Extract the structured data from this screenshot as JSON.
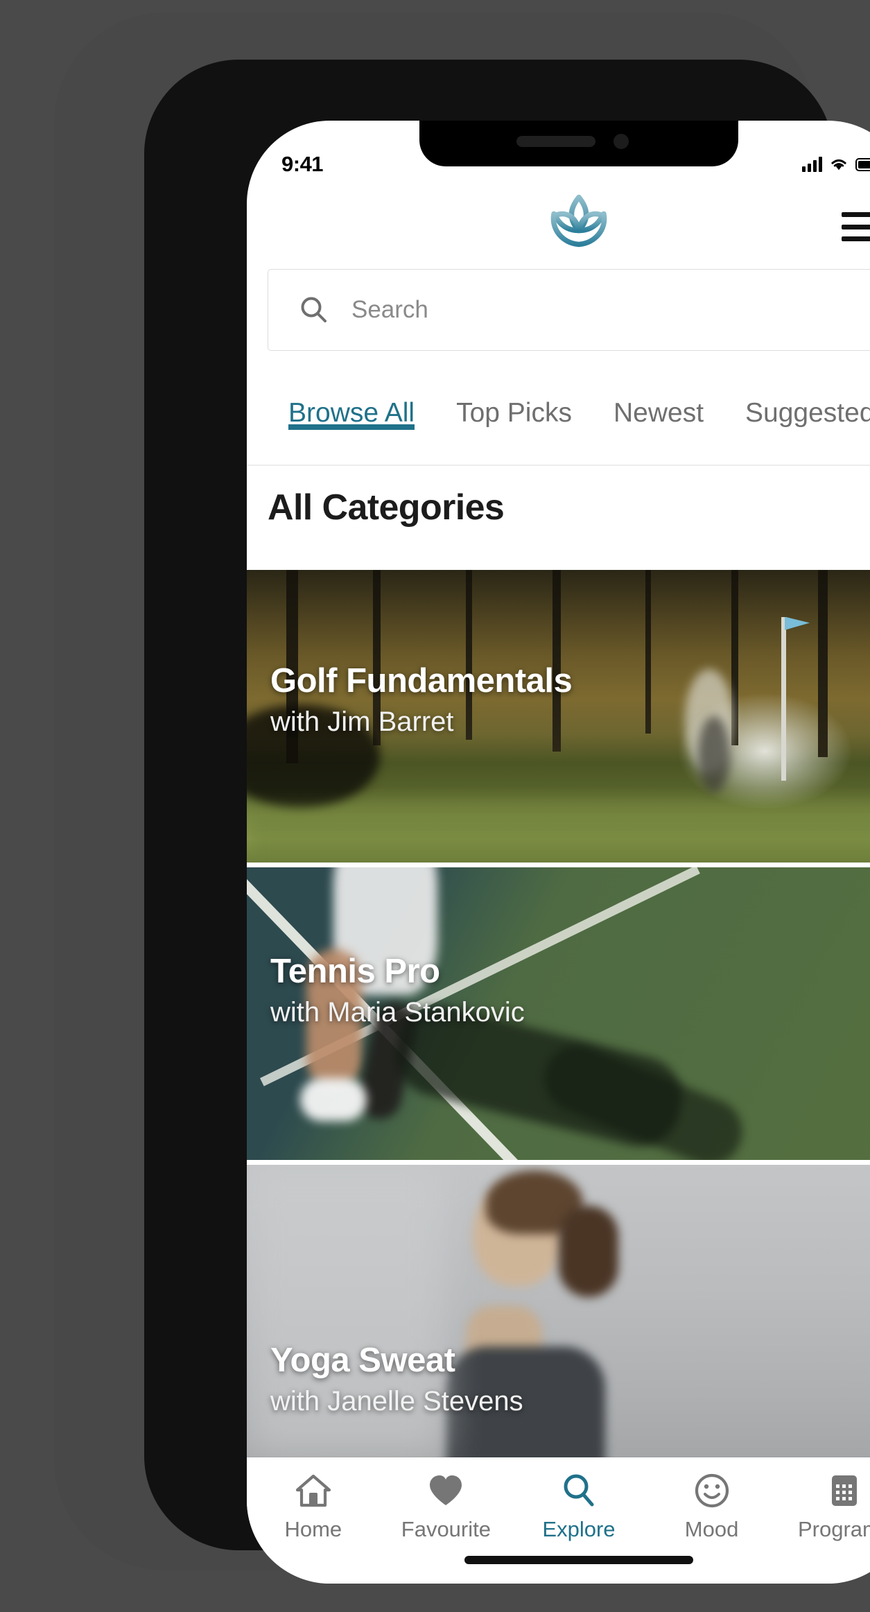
{
  "status_bar": {
    "time": "9:41",
    "signal_icon": "cellular-signal-icon",
    "wifi_icon": "wifi-icon",
    "battery_icon": "battery-full-icon"
  },
  "header": {
    "logo_icon": "lotus-logo-icon",
    "menu_icon": "hamburger-menu-icon"
  },
  "search": {
    "icon": "search-icon",
    "placeholder": "Search",
    "value": ""
  },
  "tabs": [
    {
      "label": "Browse All",
      "active": true
    },
    {
      "label": "Top Picks",
      "active": false
    },
    {
      "label": "Newest",
      "active": false
    },
    {
      "label": "Suggested P",
      "active": false
    }
  ],
  "section": {
    "title": "All Categories"
  },
  "cards": [
    {
      "title": "Golf Fundamentals",
      "subtitle": "with Jim Barret",
      "scene": "golf-course-photo"
    },
    {
      "title": "Tennis Pro",
      "subtitle": "with Maria Stankovic",
      "scene": "tennis-court-photo"
    },
    {
      "title": "Yoga Sweat",
      "subtitle": "with Janelle Stevens",
      "scene": "yoga-studio-photo"
    }
  ],
  "bottom_nav": [
    {
      "label": "Home",
      "icon": "home-icon",
      "active": false
    },
    {
      "label": "Favourite",
      "icon": "heart-icon",
      "active": false
    },
    {
      "label": "Explore",
      "icon": "search-icon",
      "active": true
    },
    {
      "label": "Mood",
      "icon": "smiley-face-icon",
      "active": false
    },
    {
      "label": "Programs",
      "icon": "calendar-grid-icon",
      "active": false
    }
  ],
  "colors": {
    "accent": "#20718a",
    "logo_light": "#7fb4c4",
    "logo_dark": "#2c7f9c",
    "inactive_text": "#767676",
    "frame": "#484848"
  }
}
